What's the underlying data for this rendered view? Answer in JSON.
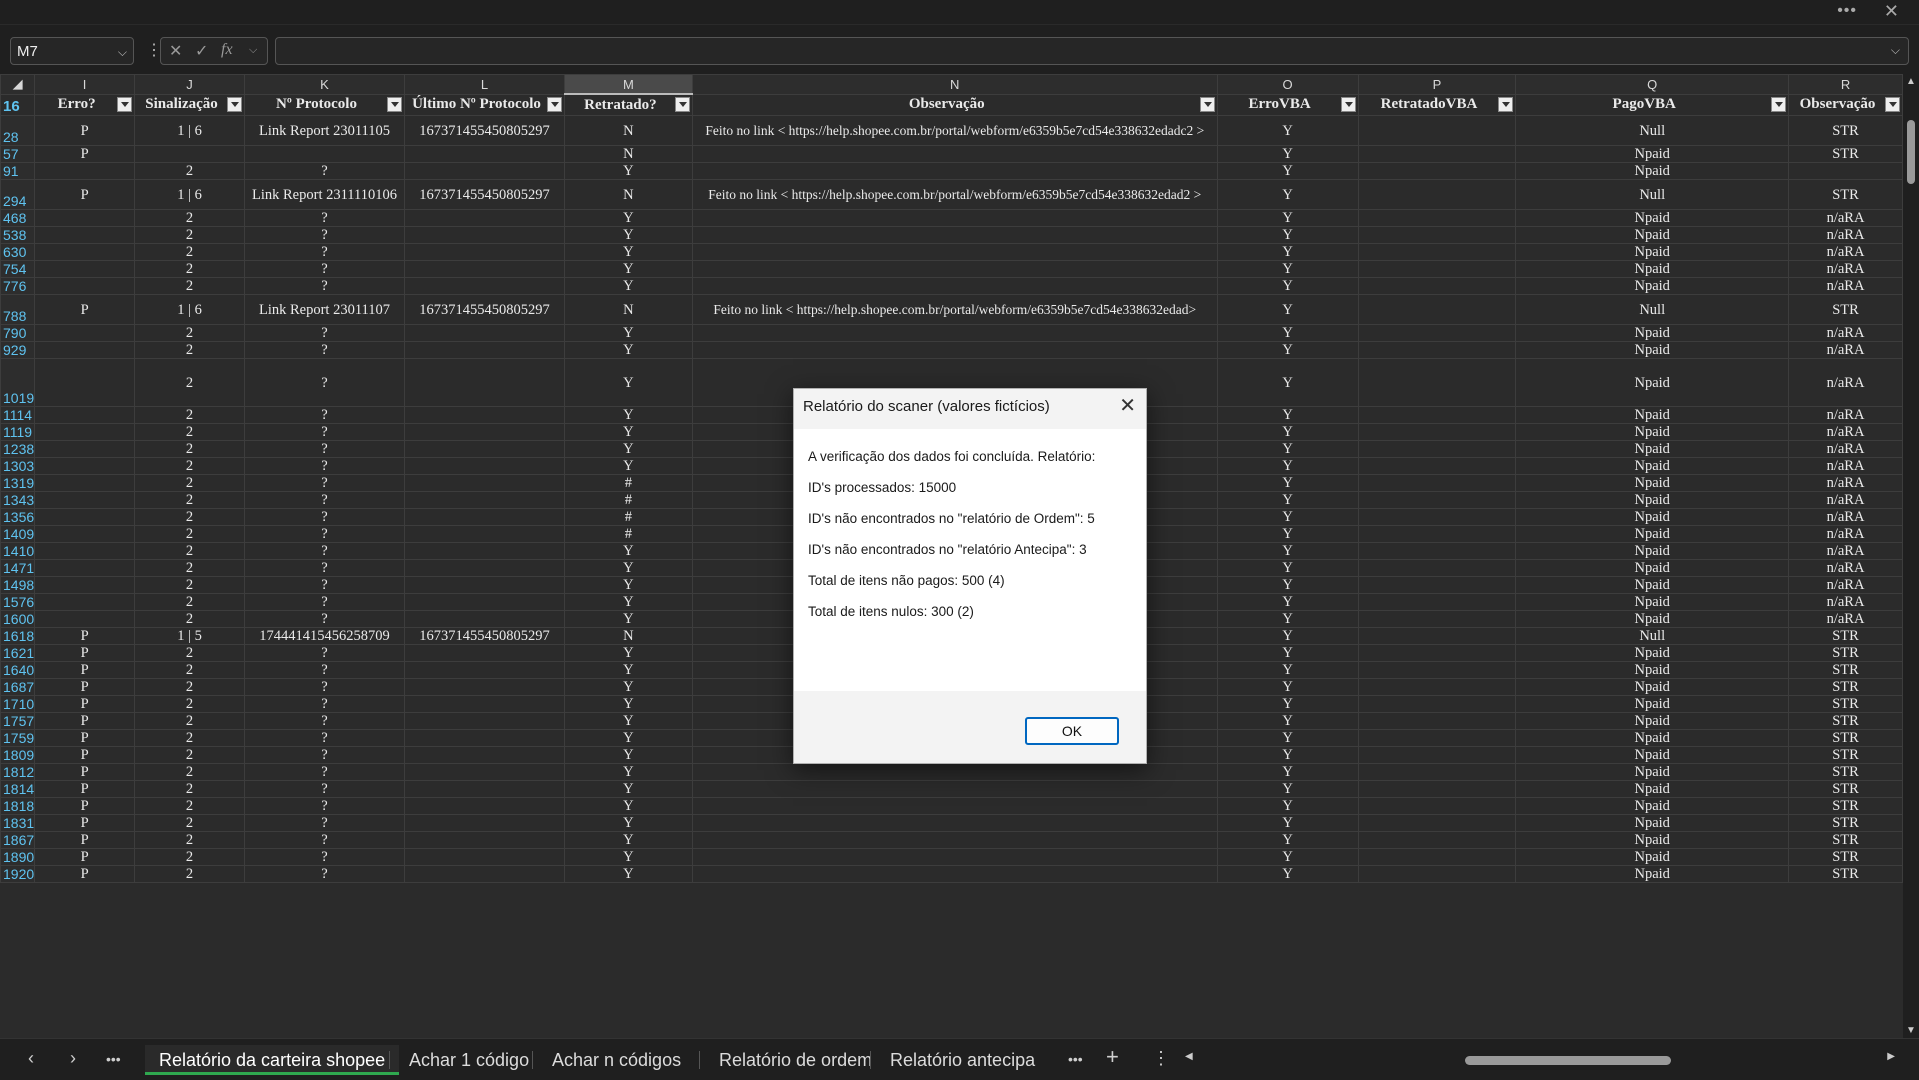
{
  "window": {
    "more_icon": "ellipsis-icon",
    "close_icon": "close-icon"
  },
  "formula_bar": {
    "cell_ref": "M7",
    "formula": ""
  },
  "columns": [
    {
      "letter": "I",
      "header": "Erro?"
    },
    {
      "letter": "J",
      "header": "Sinalização"
    },
    {
      "letter": "K",
      "header": "Nº Protocolo"
    },
    {
      "letter": "L",
      "header": "Último Nº Protocolo"
    },
    {
      "letter": "M",
      "header": "Retratado?"
    },
    {
      "letter": "N",
      "header": "Observação"
    },
    {
      "letter": "O",
      "header": "ErroVBA"
    },
    {
      "letter": "P",
      "header": "RetratadoVBA"
    },
    {
      "letter": "Q",
      "header": "PagoVBA"
    },
    {
      "letter": "R",
      "header": "Observação"
    }
  ],
  "header_row_number": "16",
  "rows": [
    {
      "n": "28",
      "c": [
        "P",
        "1 | 6",
        "Link Report 23011105",
        "167371455450805297",
        "N",
        "Feito no link < https://help.shopee.com.br/portal/webform/e6359b5e7cd54e338632edadc2 >",
        "Y",
        "",
        "Null",
        "STR"
      ],
      "tall": true
    },
    {
      "n": "57",
      "c": [
        "P",
        "",
        "",
        "",
        "N",
        "",
        "Y",
        "",
        "Npaid",
        "STR"
      ]
    },
    {
      "n": "91",
      "c": [
        "",
        "2",
        "?",
        "",
        "Y",
        "",
        "Y",
        "",
        "Npaid",
        ""
      ]
    },
    {
      "n": "294",
      "c": [
        "P",
        "1 | 6",
        "Link Report 2311110106",
        "167371455450805297",
        "N",
        "Feito no link < https://help.shopee.com.br/portal/webform/e6359b5e7cd54e338632edad2 >",
        "Y",
        "",
        "Null",
        "STR"
      ],
      "tall": true
    },
    {
      "n": "468",
      "c": [
        "",
        "2",
        "?",
        "",
        "Y",
        "",
        "Y",
        "",
        "Npaid",
        "n/aRA"
      ]
    },
    {
      "n": "538",
      "c": [
        "",
        "2",
        "?",
        "",
        "Y",
        "",
        "Y",
        "",
        "Npaid",
        "n/aRA"
      ]
    },
    {
      "n": "630",
      "c": [
        "",
        "2",
        "?",
        "",
        "Y",
        "",
        "Y",
        "",
        "Npaid",
        "n/aRA"
      ]
    },
    {
      "n": "754",
      "c": [
        "",
        "2",
        "?",
        "",
        "Y",
        "",
        "Y",
        "",
        "Npaid",
        "n/aRA"
      ]
    },
    {
      "n": "776",
      "c": [
        "",
        "2",
        "?",
        "",
        "Y",
        "",
        "Y",
        "",
        "Npaid",
        "n/aRA"
      ]
    },
    {
      "n": "788",
      "c": [
        "P",
        "1 | 6",
        "Link Report 23011107",
        "167371455450805297",
        "N",
        "Feito no link < https://help.shopee.com.br/portal/webform/e6359b5e7cd54e338632edad>",
        "Y",
        "",
        "Null",
        "STR"
      ],
      "tall": true
    },
    {
      "n": "790",
      "c": [
        "",
        "2",
        "?",
        "",
        "Y",
        "",
        "Y",
        "",
        "Npaid",
        "n/aRA"
      ]
    },
    {
      "n": "929",
      "c": [
        "",
        "2",
        "?",
        "",
        "Y",
        "",
        "Y",
        "",
        "Npaid",
        "n/aRA"
      ]
    },
    {
      "n": "1019",
      "c": [
        "",
        "2",
        "?",
        "",
        "Y",
        "",
        "Y",
        "",
        "Npaid",
        "n/aRA"
      ],
      "xtall": true
    },
    {
      "n": "1114",
      "c": [
        "",
        "2",
        "?",
        "",
        "Y",
        "",
        "Y",
        "",
        "Npaid",
        "n/aRA"
      ]
    },
    {
      "n": "1119",
      "c": [
        "",
        "2",
        "?",
        "",
        "Y",
        "",
        "Y",
        "",
        "Npaid",
        "n/aRA"
      ]
    },
    {
      "n": "1238",
      "c": [
        "",
        "2",
        "?",
        "",
        "Y",
        "",
        "Y",
        "",
        "Npaid",
        "n/aRA"
      ]
    },
    {
      "n": "1303",
      "c": [
        "",
        "2",
        "?",
        "",
        "Y",
        "",
        "Y",
        "",
        "Npaid",
        "n/aRA"
      ]
    },
    {
      "n": "1319",
      "c": [
        "",
        "2",
        "?",
        "",
        "#",
        "",
        "Y",
        "",
        "Npaid",
        "n/aRA"
      ]
    },
    {
      "n": "1343",
      "c": [
        "",
        "2",
        "?",
        "",
        "#",
        "",
        "Y",
        "",
        "Npaid",
        "n/aRA"
      ]
    },
    {
      "n": "1356",
      "c": [
        "",
        "2",
        "?",
        "",
        "#",
        "",
        "Y",
        "",
        "Npaid",
        "n/aRA"
      ]
    },
    {
      "n": "1409",
      "c": [
        "",
        "2",
        "?",
        "",
        "#",
        "",
        "Y",
        "",
        "Npaid",
        "n/aRA"
      ]
    },
    {
      "n": "1410",
      "c": [
        "",
        "2",
        "?",
        "",
        "Y",
        "",
        "Y",
        "",
        "Npaid",
        "n/aRA"
      ]
    },
    {
      "n": "1471",
      "c": [
        "",
        "2",
        "?",
        "",
        "Y",
        "",
        "Y",
        "",
        "Npaid",
        "n/aRA"
      ]
    },
    {
      "n": "1498",
      "c": [
        "",
        "2",
        "?",
        "",
        "Y",
        "",
        "Y",
        "",
        "Npaid",
        "n/aRA"
      ]
    },
    {
      "n": "1576",
      "c": [
        "",
        "2",
        "?",
        "",
        "Y",
        "",
        "Y",
        "",
        "Npaid",
        "n/aRA"
      ]
    },
    {
      "n": "1600",
      "c": [
        "",
        "2",
        "?",
        "",
        "Y",
        "",
        "Y",
        "",
        "Npaid",
        "n/aRA"
      ]
    },
    {
      "n": "1618",
      "c": [
        "P",
        "1 | 5",
        "174441415456258709",
        "167371455450805297",
        "N",
        "",
        "Y",
        "",
        "Null",
        "STR"
      ]
    },
    {
      "n": "1621",
      "c": [
        "P",
        "2",
        "?",
        "",
        "Y",
        "",
        "Y",
        "",
        "Npaid",
        "STR"
      ]
    },
    {
      "n": "1640",
      "c": [
        "P",
        "2",
        "?",
        "",
        "Y",
        "",
        "Y",
        "",
        "Npaid",
        "STR"
      ]
    },
    {
      "n": "1687",
      "c": [
        "P",
        "2",
        "?",
        "",
        "Y",
        "",
        "Y",
        "",
        "Npaid",
        "STR"
      ]
    },
    {
      "n": "1710",
      "c": [
        "P",
        "2",
        "?",
        "",
        "Y",
        "",
        "Y",
        "",
        "Npaid",
        "STR"
      ]
    },
    {
      "n": "1757",
      "c": [
        "P",
        "2",
        "?",
        "",
        "Y",
        "",
        "Y",
        "",
        "Npaid",
        "STR"
      ]
    },
    {
      "n": "1759",
      "c": [
        "P",
        "2",
        "?",
        "",
        "Y",
        "",
        "Y",
        "",
        "Npaid",
        "STR"
      ]
    },
    {
      "n": "1809",
      "c": [
        "P",
        "2",
        "?",
        "",
        "Y",
        "",
        "Y",
        "",
        "Npaid",
        "STR"
      ]
    },
    {
      "n": "1812",
      "c": [
        "P",
        "2",
        "?",
        "",
        "Y",
        "",
        "Y",
        "",
        "Npaid",
        "STR"
      ]
    },
    {
      "n": "1814",
      "c": [
        "P",
        "2",
        "?",
        "",
        "Y",
        "",
        "Y",
        "",
        "Npaid",
        "STR"
      ]
    },
    {
      "n": "1818",
      "c": [
        "P",
        "2",
        "?",
        "",
        "Y",
        "",
        "Y",
        "",
        "Npaid",
        "STR"
      ]
    },
    {
      "n": "1831",
      "c": [
        "P",
        "2",
        "?",
        "",
        "Y",
        "",
        "Y",
        "",
        "Npaid",
        "STR"
      ]
    },
    {
      "n": "1867",
      "c": [
        "P",
        "2",
        "?",
        "",
        "Y",
        "",
        "Y",
        "",
        "Npaid",
        "STR"
      ]
    },
    {
      "n": "1890",
      "c": [
        "P",
        "2",
        "?",
        "",
        "Y",
        "",
        "Y",
        "",
        "Npaid",
        "STR"
      ]
    },
    {
      "n": "1920",
      "c": [
        "P",
        "2",
        "?",
        "",
        "Y",
        "",
        "Y",
        "",
        "Npaid",
        "STR"
      ]
    }
  ],
  "dialog": {
    "title": "Relatório do scaner (valores fictícios)",
    "lines": [
      "A verificação dos dados foi concluída. Relatório:",
      "ID's processados: 15000",
      "ID's não encontrados no \"relatório de Ordem\": 5",
      "ID's não encontrados no \"relatório Antecipa\": 3",
      "Total de itens não pagos: 500 (4)",
      "Total de itens nulos: 300 (2)"
    ],
    "ok_label": "OK"
  },
  "sheet_tabs": [
    {
      "label": "Relatório da carteira shopee",
      "active": true
    },
    {
      "label": "Achar 1 código",
      "active": false
    },
    {
      "label": "Achar n códigos",
      "active": false
    },
    {
      "label": "Relatório de ordem",
      "active": false
    },
    {
      "label": "Relatório antecipa",
      "active": false
    }
  ],
  "colors": {
    "accent_tab": "#2fa84f",
    "row_number": "#5fc3f0",
    "ok_border": "#0067c0"
  }
}
